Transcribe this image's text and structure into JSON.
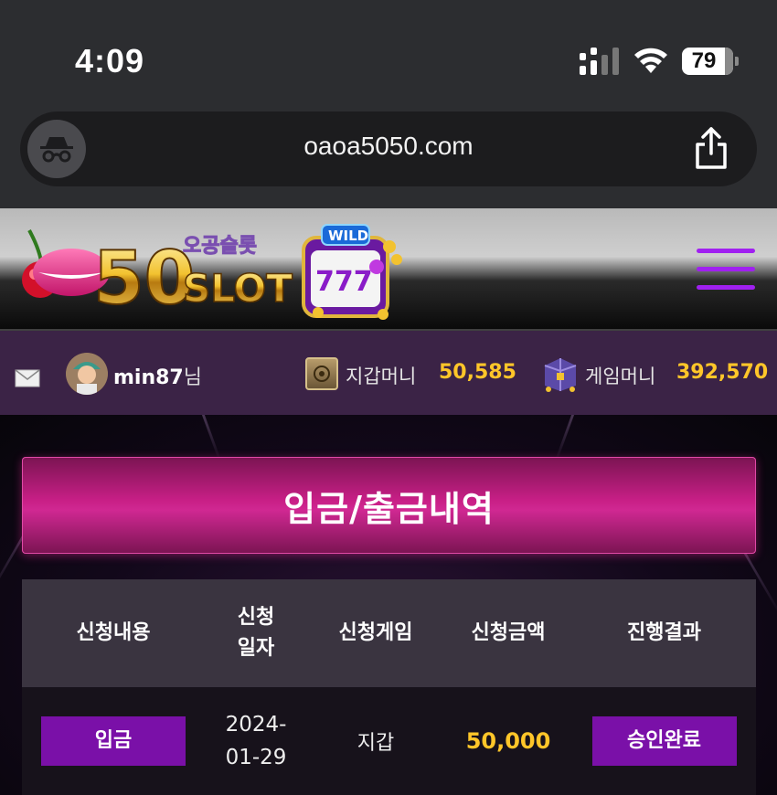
{
  "status_bar": {
    "time": "4:09",
    "battery": "79"
  },
  "browser": {
    "url": "oaoa5050.com"
  },
  "header": {
    "logo_big": "50",
    "logo_small": "SLOT",
    "logo_korean": "오공슬롯",
    "reel_badge": "WILD",
    "reel_digits": "777",
    "accent_color": "#a020f0"
  },
  "user": {
    "username": "min87",
    "honorific": "님",
    "wallet_label": "지갑머니",
    "wallet_value": "50,585",
    "game_label": "게임머니",
    "game_value": "392,570"
  },
  "page_title": "입금/출금내역",
  "table": {
    "headers": [
      "신청내용",
      "신청\n일자",
      "신청게임",
      "신청금액",
      "진행결과"
    ],
    "rows": [
      {
        "type": "입금",
        "date_line1": "2024-",
        "date_line2": "01-29",
        "game": "지갑",
        "amount": "50,000",
        "result": "승인완료"
      }
    ]
  }
}
